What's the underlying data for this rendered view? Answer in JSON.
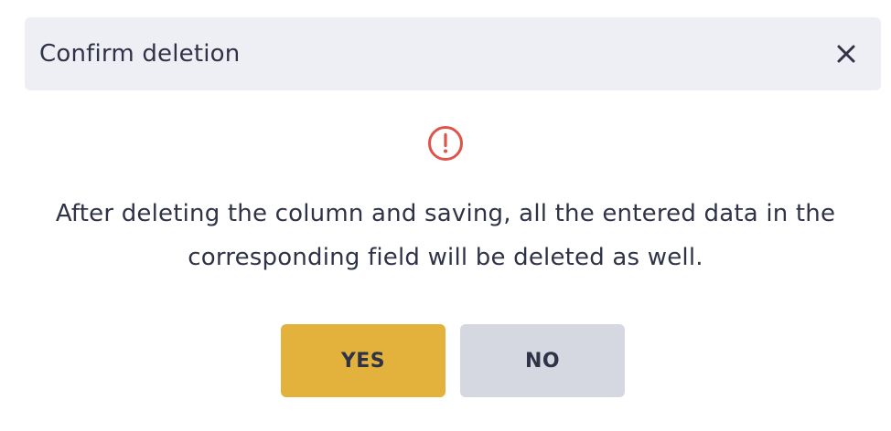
{
  "dialog": {
    "title": "Confirm deletion",
    "message_line1": "After deleting the column and saving, all the entered data in the",
    "message_line2": "corresponding field will be deleted as well.",
    "yes_label": "YES",
    "no_label": "NO",
    "close_icon": "close-icon",
    "warning_icon": "exclamation-circle-icon"
  },
  "colors": {
    "header_bg": "#eeeff4",
    "warning": "#e0534a",
    "yes_bg": "#e2b23d",
    "no_bg": "#d6d8e1",
    "text": "#2f3347"
  }
}
